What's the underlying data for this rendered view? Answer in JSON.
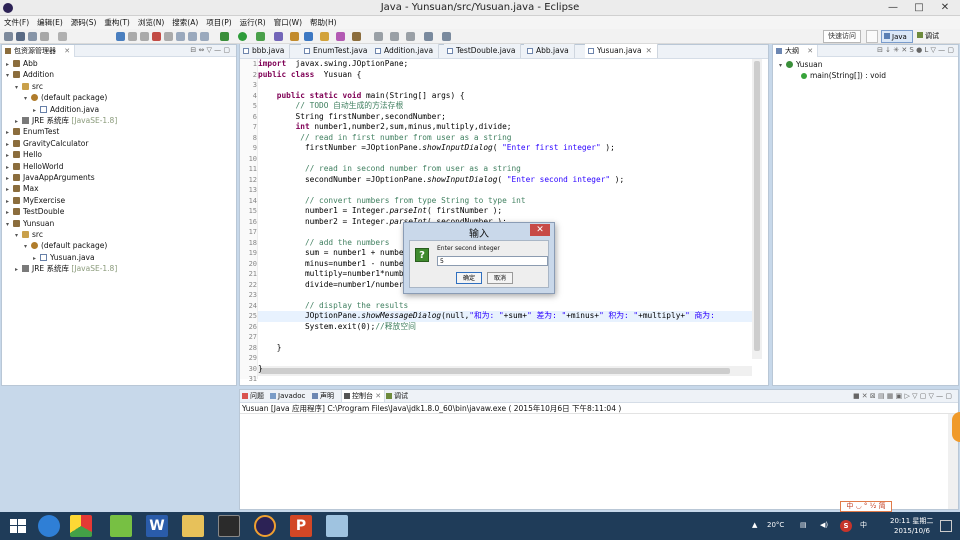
{
  "window": {
    "title": "Java - Yunsuan/src/Yusuan.java - Eclipse",
    "minimize": "—",
    "maximize": "□",
    "close": "✕"
  },
  "menu": [
    "文件(F)",
    "编辑(E)",
    "源码(S)",
    "重构(T)",
    "浏览(N)",
    "搜索(A)",
    "项目(P)",
    "运行(R)",
    "窗口(W)",
    "帮助(H)"
  ],
  "toolbar": {
    "quick_access": "快速访问",
    "perspective_java": "Java",
    "perspective_debug": "调试"
  },
  "package_explorer": {
    "tab": "包资源管理器",
    "items": [
      {
        "label": "Abb",
        "depth": 0,
        "type": "project",
        "twisty": "▸"
      },
      {
        "label": "Addition",
        "depth": 0,
        "type": "project",
        "twisty": "▾"
      },
      {
        "label": "src",
        "depth": 1,
        "type": "folder",
        "twisty": "▾"
      },
      {
        "label": "(default package)",
        "depth": 2,
        "type": "package",
        "twisty": "▾"
      },
      {
        "label": "Addition.java",
        "depth": 3,
        "type": "java",
        "twisty": "▸"
      },
      {
        "label": "JRE 系统库",
        "suffix": " [JavaSE-1.8]",
        "depth": 1,
        "type": "jre",
        "twisty": "▸"
      },
      {
        "label": "EnumTest",
        "depth": 0,
        "type": "project",
        "twisty": "▸"
      },
      {
        "label": "GravityCalculator",
        "depth": 0,
        "type": "project",
        "twisty": "▸"
      },
      {
        "label": "Hello",
        "depth": 0,
        "type": "project",
        "twisty": "▸"
      },
      {
        "label": "HelloWorld",
        "depth": 0,
        "type": "project",
        "twisty": "▸"
      },
      {
        "label": "JavaAppArguments",
        "depth": 0,
        "type": "project",
        "twisty": "▸"
      },
      {
        "label": "Max",
        "depth": 0,
        "type": "project",
        "twisty": "▸"
      },
      {
        "label": "MyExercise",
        "depth": 0,
        "type": "project",
        "twisty": "▸"
      },
      {
        "label": "TestDouble",
        "depth": 0,
        "type": "project",
        "twisty": "▸"
      },
      {
        "label": "Yunsuan",
        "depth": 0,
        "type": "project",
        "twisty": "▾"
      },
      {
        "label": "src",
        "depth": 1,
        "type": "folder",
        "twisty": "▾"
      },
      {
        "label": "(default package)",
        "depth": 2,
        "type": "package",
        "twisty": "▾"
      },
      {
        "label": "Yusuan.java",
        "depth": 3,
        "type": "java",
        "twisty": "▸"
      },
      {
        "label": "JRE 系统库",
        "suffix": " [JavaSE-1.8]",
        "depth": 1,
        "type": "jre",
        "twisty": "▸"
      }
    ]
  },
  "editor": {
    "tabs": [
      "bbb.java",
      "EnumTest.java",
      "Addition.java",
      "TestDouble.java",
      "Abb.java",
      "Yusuan.java"
    ],
    "active_tab": "Yusuan.java",
    "lines": [
      [
        [
          "kw",
          "import"
        ],
        [
          "",
          "  javax.swing.JOptionPane;"
        ]
      ],
      [
        [
          "kw",
          "public class"
        ],
        [
          "",
          "  Yusuan {"
        ]
      ],
      [],
      [
        [
          "",
          "    "
        ],
        [
          "kw",
          "public static void"
        ],
        [
          "",
          " main(String[] args) {"
        ]
      ],
      [
        [
          "cm",
          "        // TODO 自动生成的方法存根"
        ]
      ],
      [
        [
          "",
          "        String firstNumber,secondNumber;"
        ]
      ],
      [
        [
          "",
          "        "
        ],
        [
          "kw",
          "int"
        ],
        [
          "",
          " number1,number2,sum,minus,multiply,divide;"
        ]
      ],
      [
        [
          "cm",
          "         // read in first number from user as a string"
        ]
      ],
      [
        [
          "",
          "          firstNumber =JOptionPane."
        ],
        [
          "it",
          "showInputDialog"
        ],
        [
          "",
          "( "
        ],
        [
          "st",
          "\"Enter first integer\""
        ],
        [
          "",
          " );"
        ]
      ],
      [],
      [
        [
          "cm",
          "          // read in second number from user as a string"
        ]
      ],
      [
        [
          "",
          "          secondNumber =JOptionPane."
        ],
        [
          "it",
          "showInputDialog"
        ],
        [
          "",
          "( "
        ],
        [
          "st",
          "\"Enter second integer\""
        ],
        [
          "",
          " );"
        ]
      ],
      [],
      [
        [
          "cm",
          "          // convert numbers from type String to type int"
        ]
      ],
      [
        [
          "",
          "          number1 = Integer."
        ],
        [
          "it",
          "parseInt"
        ],
        [
          "",
          "( firstNumber );"
        ]
      ],
      [
        [
          "",
          "          number2 = Integer."
        ],
        [
          "it",
          "parseInt"
        ],
        [
          "",
          "( secondNumber );"
        ]
      ],
      [],
      [
        [
          "cm",
          "          // add the numbers"
        ]
      ],
      [
        [
          "",
          "          sum = number1 + number2;"
        ]
      ],
      [
        [
          "",
          "          minus=number1 - number2;"
        ]
      ],
      [
        [
          "",
          "          multiply=number1*number2;"
        ]
      ],
      [
        [
          "",
          "          divide=number1/number2;"
        ]
      ],
      [],
      [
        [
          "cm",
          "          // display the results"
        ]
      ],
      [
        [
          "",
          "          JOptionPane."
        ],
        [
          "it",
          "showMessageDialog"
        ],
        [
          "",
          "(null,"
        ],
        [
          "st",
          "\"和为: \""
        ],
        [
          "",
          "+sum+"
        ],
        [
          "st",
          "\" 差为: \""
        ],
        [
          "",
          "+minus+"
        ],
        [
          "st",
          "\" 积为: \""
        ],
        [
          "",
          "+multiply+"
        ],
        [
          "st",
          "\" 商为:"
        ]
      ],
      [
        [
          "",
          "          System.exit(0);"
        ],
        [
          "cm",
          "//释放空间"
        ]
      ],
      [],
      [
        [
          "",
          "    }"
        ]
      ],
      [],
      [
        [
          "",
          "}"
        ]
      ],
      []
    ]
  },
  "outline": {
    "tab": "大纲",
    "class": "Yusuan",
    "method": "main(String[]) : void"
  },
  "console": {
    "tabs": [
      "问题",
      "Javadoc",
      "声明",
      "控制台",
      "调试"
    ],
    "active_tab": "控制台",
    "status": "Yusuan [Java 应用程序] C:\\Program Files\\Java\\jdk1.8.0_60\\bin\\javaw.exe ( 2015年10月6日 下午8:11:04 )"
  },
  "dialog": {
    "title": "输入",
    "message": "Enter second integer",
    "input_value": "5",
    "ok": "确定",
    "cancel": "取消",
    "icon": "?",
    "close": "✕"
  },
  "ime": {
    "text": "中 ◡ ° ½ 简"
  },
  "taskbar": {
    "weather": "20°C",
    "time": "20:11 星期二",
    "date": "2015/10/6",
    "colors": {
      "bg": "#1f3c59"
    }
  },
  "colors": {
    "keyword": "#7f0055",
    "comment": "#3f7f5f",
    "string": "#2a00ff",
    "close_red": "#c74a47"
  }
}
